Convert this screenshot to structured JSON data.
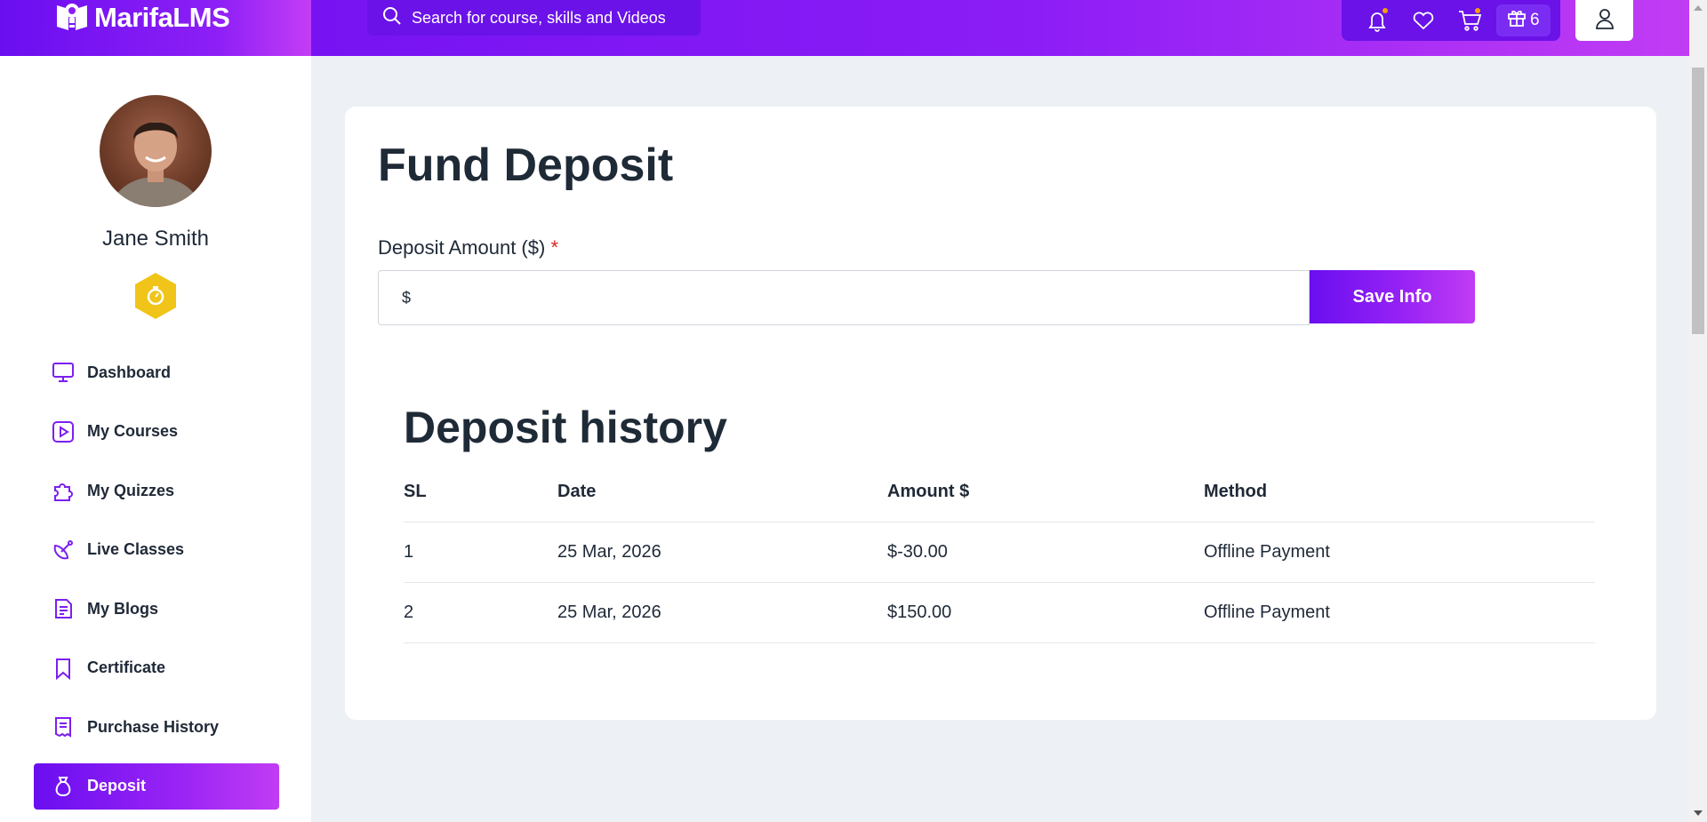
{
  "header": {
    "brand": "MarifaLMS",
    "search_placeholder": "Search for course, skills and Videos",
    "gift_count": "6",
    "icons": [
      "bell-icon",
      "heart-icon",
      "cart-icon",
      "gift-icon",
      "user-icon"
    ]
  },
  "sidebar": {
    "user_name": "Jane Smith",
    "items": [
      {
        "label": "Dashboard",
        "icon": "monitor-icon"
      },
      {
        "label": "My Courses",
        "icon": "play-square-icon"
      },
      {
        "label": "My Quizzes",
        "icon": "puzzle-icon"
      },
      {
        "label": "Live Classes",
        "icon": "satellite-dish-icon"
      },
      {
        "label": "My Blogs",
        "icon": "document-icon"
      },
      {
        "label": "Certificate",
        "icon": "bookmark-icon"
      },
      {
        "label": "Purchase History",
        "icon": "receipt-icon"
      },
      {
        "label": "Deposit",
        "icon": "money-bag-icon",
        "active": true
      }
    ]
  },
  "main": {
    "title": "Fund Deposit",
    "form": {
      "label": "Deposit Amount ($)",
      "required_mark": "*",
      "placeholder": "$",
      "value": "",
      "submit_label": "Save Info"
    },
    "history": {
      "title": "Deposit history",
      "columns": [
        "SL",
        "Date",
        "Amount $",
        "Method"
      ],
      "rows": [
        [
          "1",
          "25 Mar, 2026",
          "$-30.00",
          "Offline Payment"
        ],
        [
          "2",
          "25 Mar, 2026",
          "$150.00",
          "Offline Payment"
        ]
      ]
    }
  },
  "colors": {
    "brand_start": "#6a0ef0",
    "brand_end": "#c13cf4",
    "accent_dot": "#f59e0b",
    "required": "#dc2626",
    "badge": "#f0c419"
  }
}
